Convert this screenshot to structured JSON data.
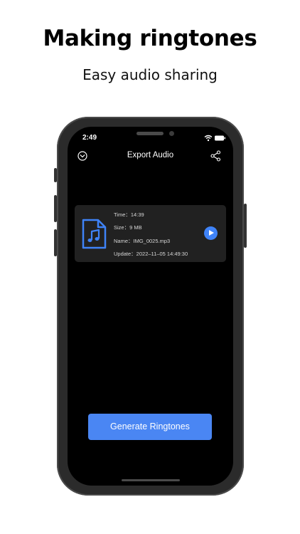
{
  "promo": {
    "headline": "Making ringtones",
    "subheadline": "Easy audio sharing"
  },
  "status_bar": {
    "time": "2:49",
    "icons": [
      "wifi-icon",
      "battery-icon"
    ]
  },
  "nav": {
    "title": "Export Audio",
    "left_icon": "chevron-down-circle-icon",
    "right_icon": "share-icon"
  },
  "file_card": {
    "icon": "music-file-icon",
    "time": "Time：14:39",
    "size": "Size：9 MB",
    "name": "Name：IMG_0025.mp3",
    "update": "Update：2022–11–05 14:49:30",
    "play_icon": "play-icon"
  },
  "actions": {
    "generate_label": "Generate Ringtones"
  },
  "colors": {
    "accent": "#4a86f3",
    "screen_bg": "#000000",
    "card_bg": "#212121"
  }
}
